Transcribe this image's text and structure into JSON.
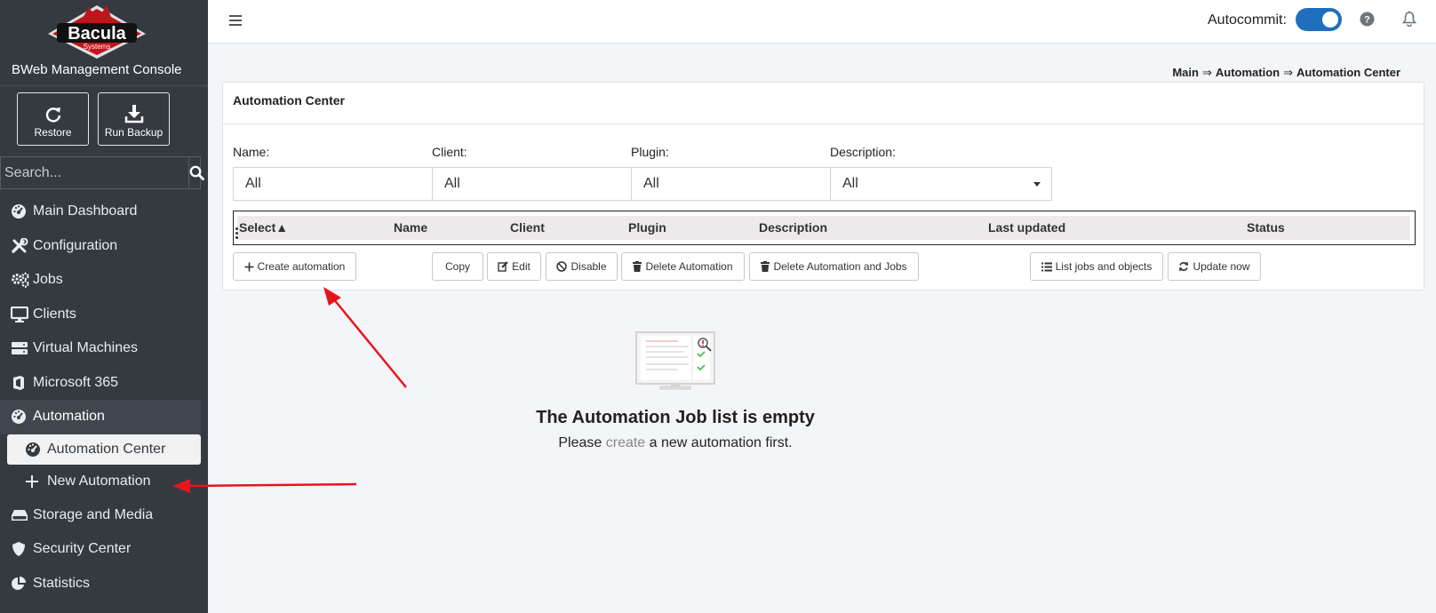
{
  "app": {
    "logo_text": "Bacula",
    "logo_sub": "Systems",
    "console_title": "BWeb Management Console"
  },
  "quick_actions": [
    {
      "label": "Restore",
      "icon": "restore-icon"
    },
    {
      "label": "Run Backup",
      "icon": "download-icon"
    }
  ],
  "search": {
    "placeholder": "Search..."
  },
  "nav": [
    {
      "label": "Main Dashboard",
      "icon": "dashboard-icon"
    },
    {
      "label": "Configuration",
      "icon": "tools-icon"
    },
    {
      "label": "Jobs",
      "icon": "gears-icon"
    },
    {
      "label": "Clients",
      "icon": "desktop-icon"
    },
    {
      "label": "Virtual Machines",
      "icon": "server-icon"
    },
    {
      "label": "Microsoft 365",
      "icon": "office-icon"
    },
    {
      "label": "Automation",
      "icon": "dashboard-icon",
      "expanded": true
    },
    {
      "label": "Storage and Media",
      "icon": "hdd-icon"
    },
    {
      "label": "Security Center",
      "icon": "shield-icon"
    },
    {
      "label": "Statistics",
      "icon": "pie-chart-icon"
    }
  ],
  "nav_sub": [
    {
      "label": "Automation Center",
      "icon": "dashboard-icon",
      "active": true
    },
    {
      "label": "New Automation",
      "icon": "plus-icon"
    }
  ],
  "header": {
    "autocommit_label": "Autocommit:",
    "autocommit_on": true
  },
  "breadcrumb": [
    "Main",
    "Automation",
    "Automation Center"
  ],
  "breadcrumb_sep": "⇒",
  "card": {
    "title": "Automation Center",
    "filters": [
      {
        "label": "Name:",
        "value": "All"
      },
      {
        "label": "Client:",
        "value": "All"
      },
      {
        "label": "Plugin:",
        "value": "All"
      },
      {
        "label": "Description:",
        "value": "All"
      }
    ],
    "columns": [
      "Select▲",
      "Name",
      "Client",
      "Plugin",
      "Description",
      "Last updated",
      "Status"
    ],
    "buttons": [
      {
        "label": "Create automation",
        "icon": "plus-icon"
      },
      {
        "label": "Copy",
        "icon": ""
      },
      {
        "label": "Edit",
        "icon": "edit-icon"
      },
      {
        "label": "Disable",
        "icon": "ban-icon"
      },
      {
        "label": "Delete Automation",
        "icon": "trash-icon"
      },
      {
        "label": "Delete Automation and Jobs",
        "icon": "trash-icon"
      },
      {
        "label": "List jobs and objects",
        "icon": "list-icon"
      },
      {
        "label": "Update now",
        "icon": "refresh-icon"
      }
    ]
  },
  "empty_state": {
    "title": "The Automation Job list is empty",
    "text_before": "Please ",
    "link": "create",
    "text_after": " a new automation first."
  },
  "colors": {
    "sidebar_bg": "#343a40",
    "toggle_on": "#1f6fbd",
    "annotation_arrow": "#e8141c"
  }
}
